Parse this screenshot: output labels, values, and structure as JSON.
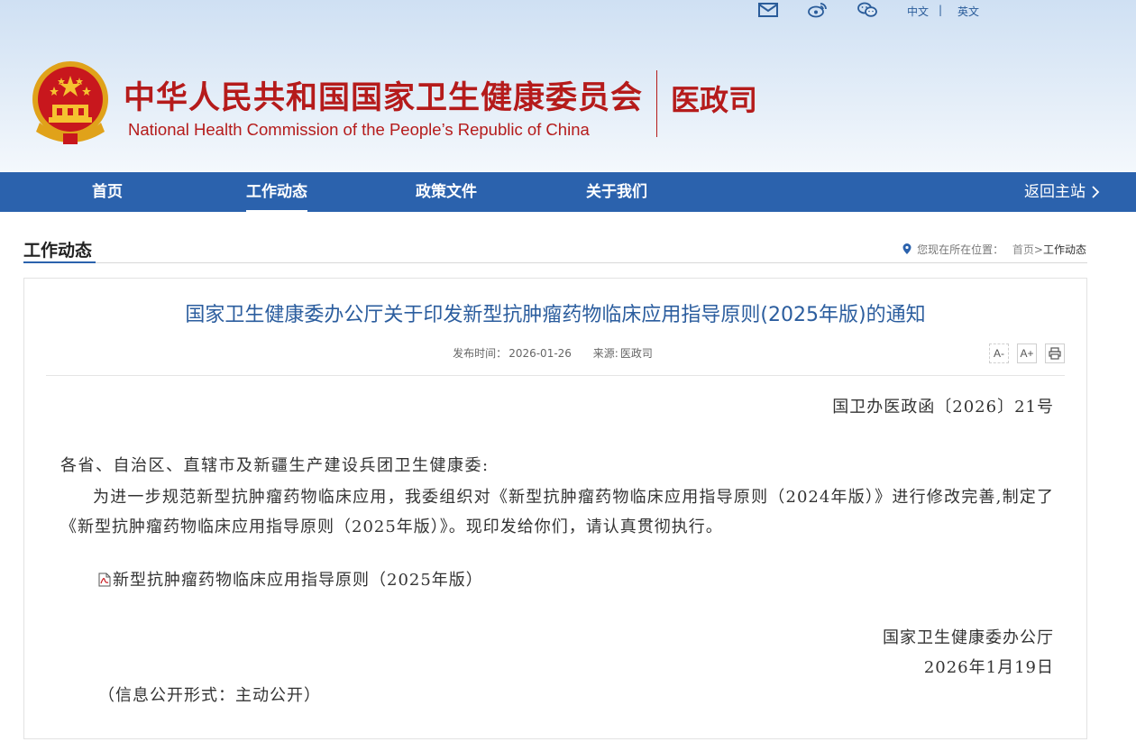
{
  "header": {
    "org_name_cn": "中华人民共和国国家卫生健康委员会",
    "org_name_en": "National Health Commission of the People’s  Republic of China",
    "dept_name": "医政司",
    "top_links": {
      "chinese": "中文",
      "separator": "|",
      "english": "英文"
    },
    "top_icons": [
      "mail-icon",
      "weibo-icon",
      "wechat-icon"
    ]
  },
  "nav": {
    "items": [
      {
        "label": "首页"
      },
      {
        "label": "工作动态",
        "active": true
      },
      {
        "label": "政策文件"
      },
      {
        "label": "关于我们"
      }
    ],
    "back_label": "返回主站"
  },
  "section": {
    "title": "工作动态",
    "breadcrumb": {
      "prefix": "您现在所在位置：",
      "home": "首页",
      "separator": ">",
      "current": "工作动态"
    }
  },
  "article": {
    "title": "国家卫生健康委办公厅关于印发新型抗肿瘤药物临床应用指导原则(2025年版)的通知",
    "publish_label": "发布时间：",
    "publish_date": "2026-01-26",
    "source_label": "来源:",
    "source": "医政司",
    "tools": {
      "font_smaller": "A-",
      "font_larger": "A+",
      "print": "print-icon"
    },
    "doc_number": "国卫办医政函〔2026〕21号",
    "salutation": "各省、自治区、直辖市及新疆生产建设兵团卫生健康委:",
    "paragraph": "为进一步规范新型抗肿瘤药物临床应用，我委组织对《新型抗肿瘤药物临床应用指导原则（2024年版）》进行修改完善,制定了《新型抗肿瘤药物临床应用指导原则（2025年版）》。现印发给你们，请认真贯彻执行。",
    "attachment": "新型抗肿瘤药物临床应用指导原则（2025年版）",
    "signer": "国家卫生健康委办公厅",
    "sign_date": "2026年1月19日",
    "disclosure": "（信息公开形式：主动公开）"
  },
  "colors": {
    "brand_red": "#b51b1b",
    "nav_blue": "#2b62ad",
    "title_blue": "#2b5d9e"
  }
}
